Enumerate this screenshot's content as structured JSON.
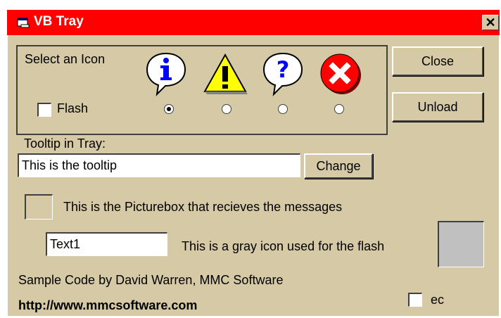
{
  "window": {
    "title": "VB Tray",
    "close_glyph": "✕"
  },
  "select_frame": {
    "label": "Select an Icon",
    "icons": [
      {
        "name": "info-icon",
        "glyph": "i",
        "color": "#0000ff",
        "selected": true
      },
      {
        "name": "warning-icon",
        "glyph": "!",
        "color": "#ffff00",
        "selected": false
      },
      {
        "name": "question-icon",
        "glyph": "?",
        "color": "#0000ff",
        "selected": false
      },
      {
        "name": "error-icon",
        "glyph": "✕",
        "color": "#ff0000",
        "selected": false
      }
    ],
    "flash_label": "Flash",
    "flash_checked": false
  },
  "buttons": {
    "close": "Close",
    "unload": "Unload",
    "change": "Change"
  },
  "tooltip": {
    "label": "Tooltip in Tray:",
    "value": "This is the tooltip"
  },
  "picturebox_label": "This is the Picturebox that recieves the messages",
  "text1_value": "Text1",
  "gray_icon_label": "This is a gray icon used for the flash",
  "credit": "Sample Code by David Warren, MMC Software",
  "url": "http://www.mmcsoftware.com",
  "ec_label": "ec",
  "ec_checked": false,
  "colors": {
    "titlebar": "#ff0000",
    "face": "#d6c9a6"
  }
}
